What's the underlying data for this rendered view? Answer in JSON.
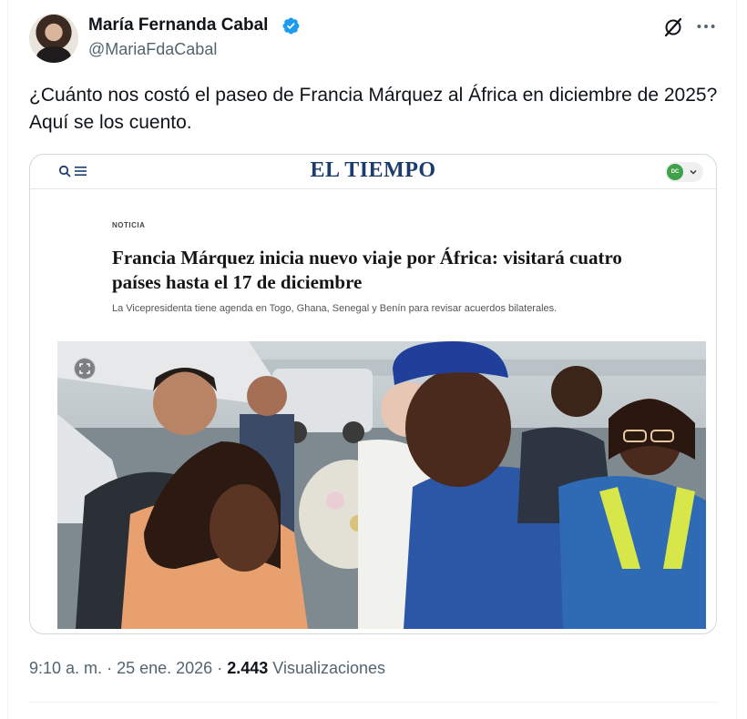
{
  "author": {
    "name": "María Fernanda Cabal",
    "handle": "@MariaFdaCabal",
    "verified": true,
    "verified_color": "#1d9bf0"
  },
  "tweet": {
    "text": "¿Cuánto nos costó el paseo de Francia Márquez al África en diciembre de 2025? Aquí se los cuento.",
    "time": "9:10 a. m.",
    "separator": "·",
    "date": "25 ene. 2026",
    "views_count": "2.443",
    "views_label": "Visualizaciones"
  },
  "actions": {
    "grok_icon": "grok-icon",
    "more_icon": "more-icon"
  },
  "article": {
    "site_name": "EL TIEMPO",
    "site_color": "#1b3c6d",
    "user_initials": "DC",
    "kicker": "NOTICIA",
    "headline": "Francia Márquez inicia nuevo viaje por África: visitará cuatro países hasta el 17 de diciembre",
    "summary": "La Vicepresidenta tiene agenda en Togo, Ghana, Senegal y Benín para revisar acuerdos bilaterales."
  }
}
